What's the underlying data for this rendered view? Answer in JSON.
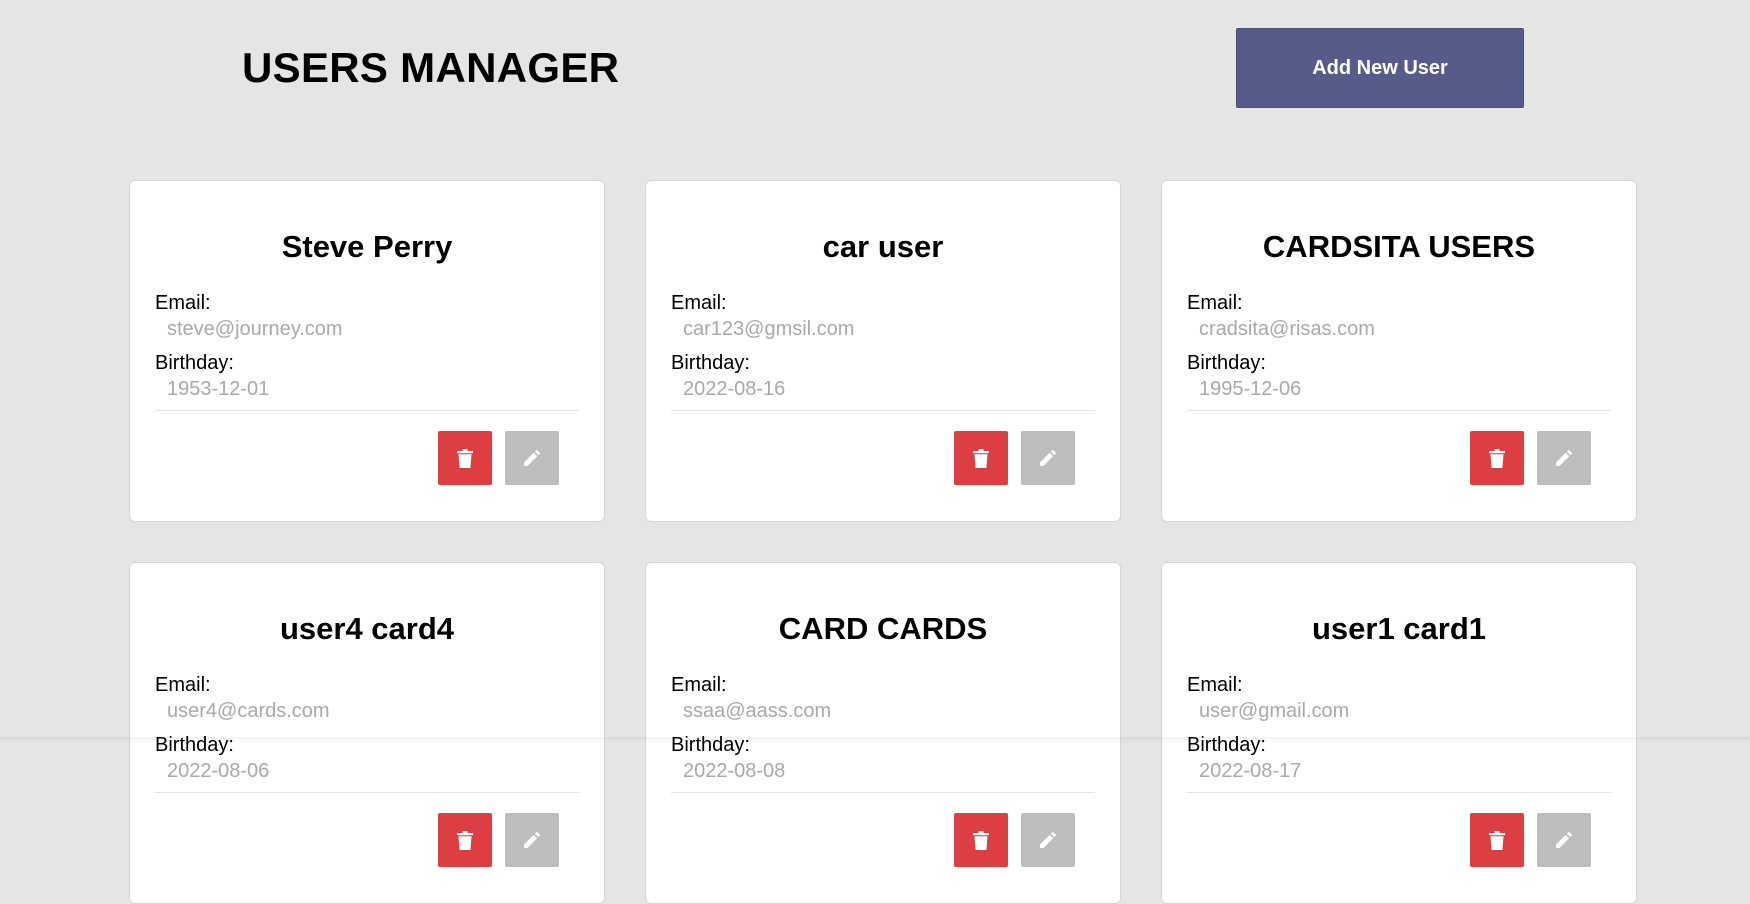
{
  "header": {
    "title": "USERS MANAGER",
    "add_button_label": "Add New User"
  },
  "labels": {
    "email": "Email:",
    "birthday": "Birthday:"
  },
  "icons": {
    "delete": "trash-icon",
    "edit": "pencil-icon"
  },
  "colors": {
    "background": "#e5e5e5",
    "primary_button": "#575b8a",
    "delete_button": "#dc3e41",
    "edit_button": "#bdbdbd",
    "value_text": "#a9a9a9"
  },
  "users": [
    {
      "name": "Steve Perry",
      "email": "steve@journey.com",
      "birthday": "1953-12-01"
    },
    {
      "name": "car user",
      "email": "car123@gmsil.com",
      "birthday": "2022-08-16"
    },
    {
      "name": "CARDSITA USERS",
      "email": "cradsita@risas.com",
      "birthday": "1995-12-06"
    },
    {
      "name": "user4 card4",
      "email": "user4@cards.com",
      "birthday": "2022-08-06"
    },
    {
      "name": "CARD CARDS",
      "email": "ssaa@aass.com",
      "birthday": "2022-08-08"
    },
    {
      "name": "user1 card1",
      "email": "user@gmail.com",
      "birthday": "2022-08-17"
    }
  ]
}
